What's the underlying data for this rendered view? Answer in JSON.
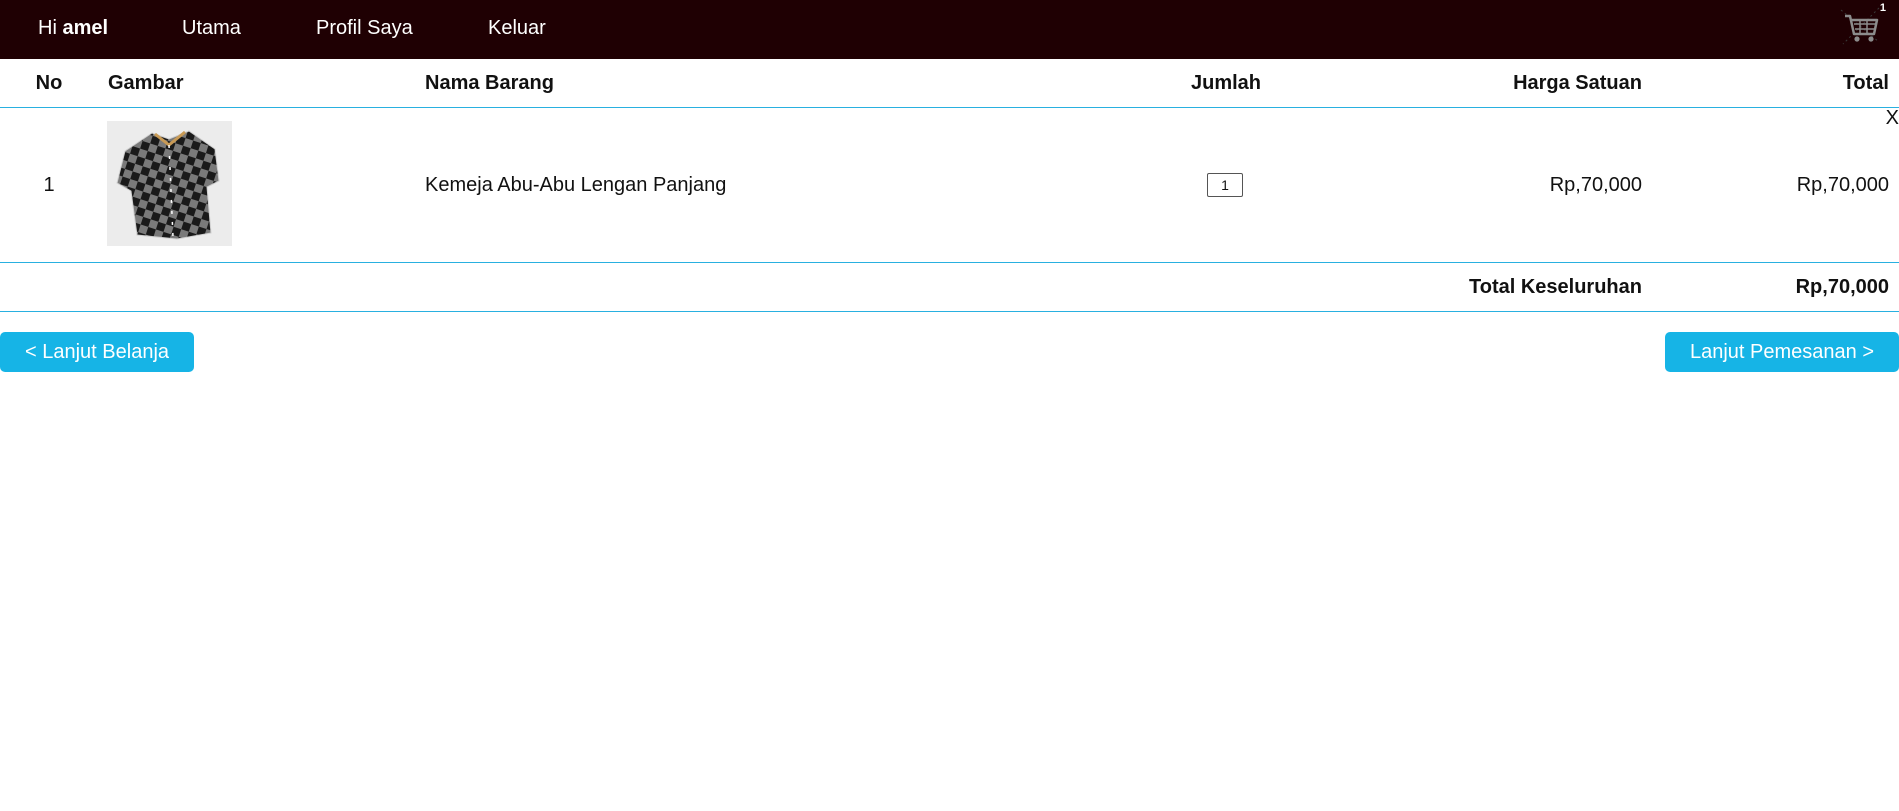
{
  "nav": {
    "greeting_prefix": "Hi ",
    "username": "amel",
    "links": [
      {
        "label": "Utama"
      },
      {
        "label": "Profil Saya"
      },
      {
        "label": "Keluar"
      }
    ],
    "cart_icon": "shopping-cart-icon",
    "cart_count": "1"
  },
  "table": {
    "headers": {
      "no": "No",
      "image": "Gambar",
      "name": "Nama Barang",
      "qty": "Jumlah",
      "unit_price": "Harga Satuan",
      "total": "Total"
    },
    "rows": [
      {
        "no": "1",
        "image_icon": "checkered-shirt-image",
        "name": "Kemeja Abu-Abu Lengan Panjang",
        "qty": "1",
        "unit_price": "Rp,70,000",
        "total": "Rp,70,000",
        "remove_label": "X"
      }
    ],
    "grand_total_label": "Total Keseluruhan",
    "grand_total_value": "Rp,70,000"
  },
  "actions": {
    "continue_shopping": "< Lanjut Belanja",
    "continue_order": "Lanjut Pemesanan >"
  },
  "colors": {
    "topbar": "#1f0003",
    "accent": "#16b4e6",
    "divider": "#29b0e0"
  }
}
